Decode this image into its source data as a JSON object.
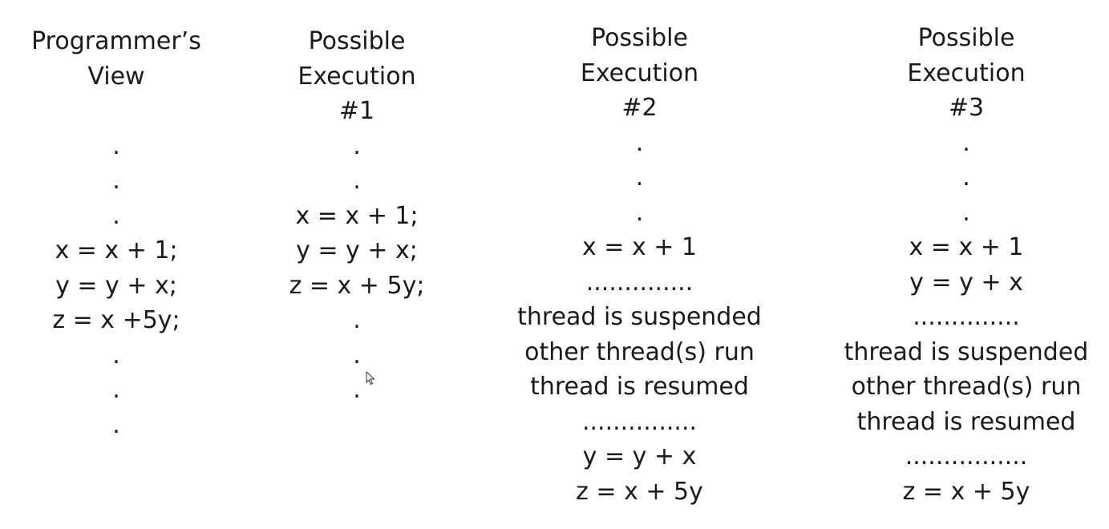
{
  "columns": [
    {
      "title": [
        "Programmer’s",
        "View"
      ],
      "lines": [
        ".",
        ".",
        ".",
        "x = x + 1;",
        "y = y + x;",
        "z = x +5y;",
        ".",
        ".",
        "."
      ]
    },
    {
      "title": [
        "Possible",
        "Execution",
        "#1"
      ],
      "lines": [
        ".",
        ".",
        "x = x + 1;",
        "y = y + x;",
        "z = x + 5y;",
        ".",
        ".",
        "."
      ]
    },
    {
      "title": [
        "Possible",
        "Execution",
        "#2"
      ],
      "lines": [
        ".",
        ".",
        ".",
        "x = x + 1",
        "..............",
        "thread is suspended",
        "other thread(s) run",
        "thread is resumed",
        "...............",
        "y = y + x",
        "z = x + 5y"
      ]
    },
    {
      "title": [
        "Possible",
        "Execution",
        "#3"
      ],
      "lines": [
        ".",
        ".",
        ".",
        "x = x + 1",
        "y = y + x",
        "..............",
        "thread is suspended",
        "other thread(s) run",
        "thread is resumed",
        "................",
        "z = x + 5y"
      ]
    }
  ]
}
